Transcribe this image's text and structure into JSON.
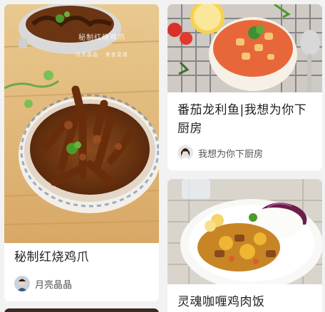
{
  "feed": {
    "cards": [
      {
        "title": "秘制红烧鸡爪",
        "author": "月亮晶晶",
        "photo_watermark": "秘制红烧鸡爪",
        "photo_sub": "月亮晶晶 · 美食菜谱",
        "photo": "braised-chicken-feet-photo"
      },
      {
        "title": "番茄龙利鱼|我想为你下厨房",
        "author": "我想为你下厨房",
        "photo": "tomato-fish-soup-photo"
      },
      {
        "title": "灵魂咖喱鸡肉饭",
        "photo": "curry-chicken-rice-photo"
      }
    ]
  },
  "colors": {
    "background": "#f2f2f2",
    "card": "#ffffff",
    "title_text": "#222222",
    "author_text": "#555555"
  }
}
